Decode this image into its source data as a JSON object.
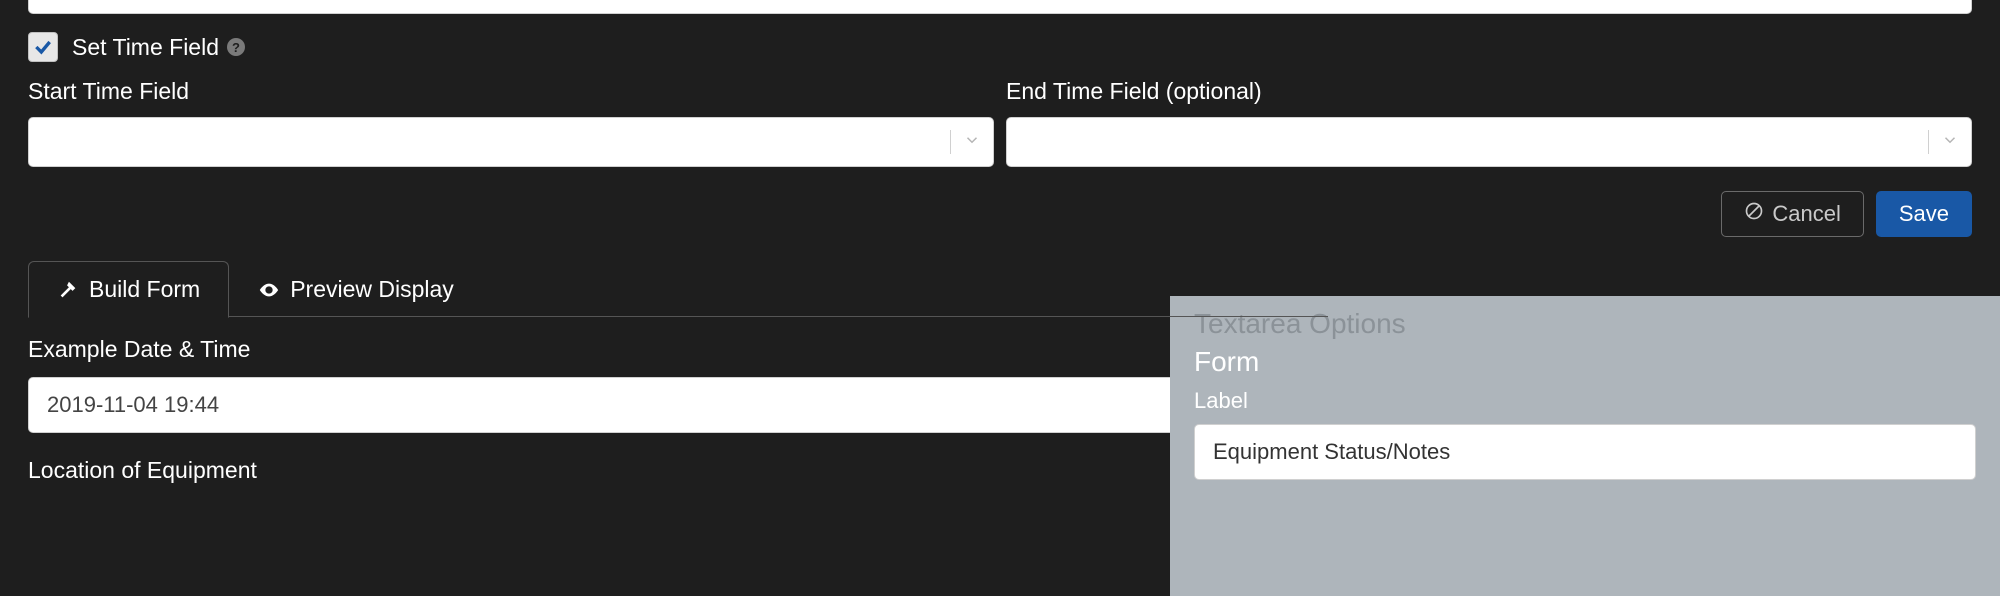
{
  "checkbox": {
    "label": "Set Time Field",
    "checked": true
  },
  "fields": {
    "start": {
      "label": "Start Time Field"
    },
    "end": {
      "label": "End Time Field (optional)"
    }
  },
  "buttons": {
    "cancel": "Cancel",
    "save": "Save"
  },
  "tabs": {
    "build": "Build Form",
    "preview": "Preview Display"
  },
  "example": {
    "label": "Example Date & Time",
    "value": "2019-11-04 19:44"
  },
  "location": {
    "label": "Location of Equipment"
  },
  "panel": {
    "title": "Textarea Options",
    "section": "Form",
    "label_text": "Label",
    "input_value": "Equipment Status/Notes"
  }
}
